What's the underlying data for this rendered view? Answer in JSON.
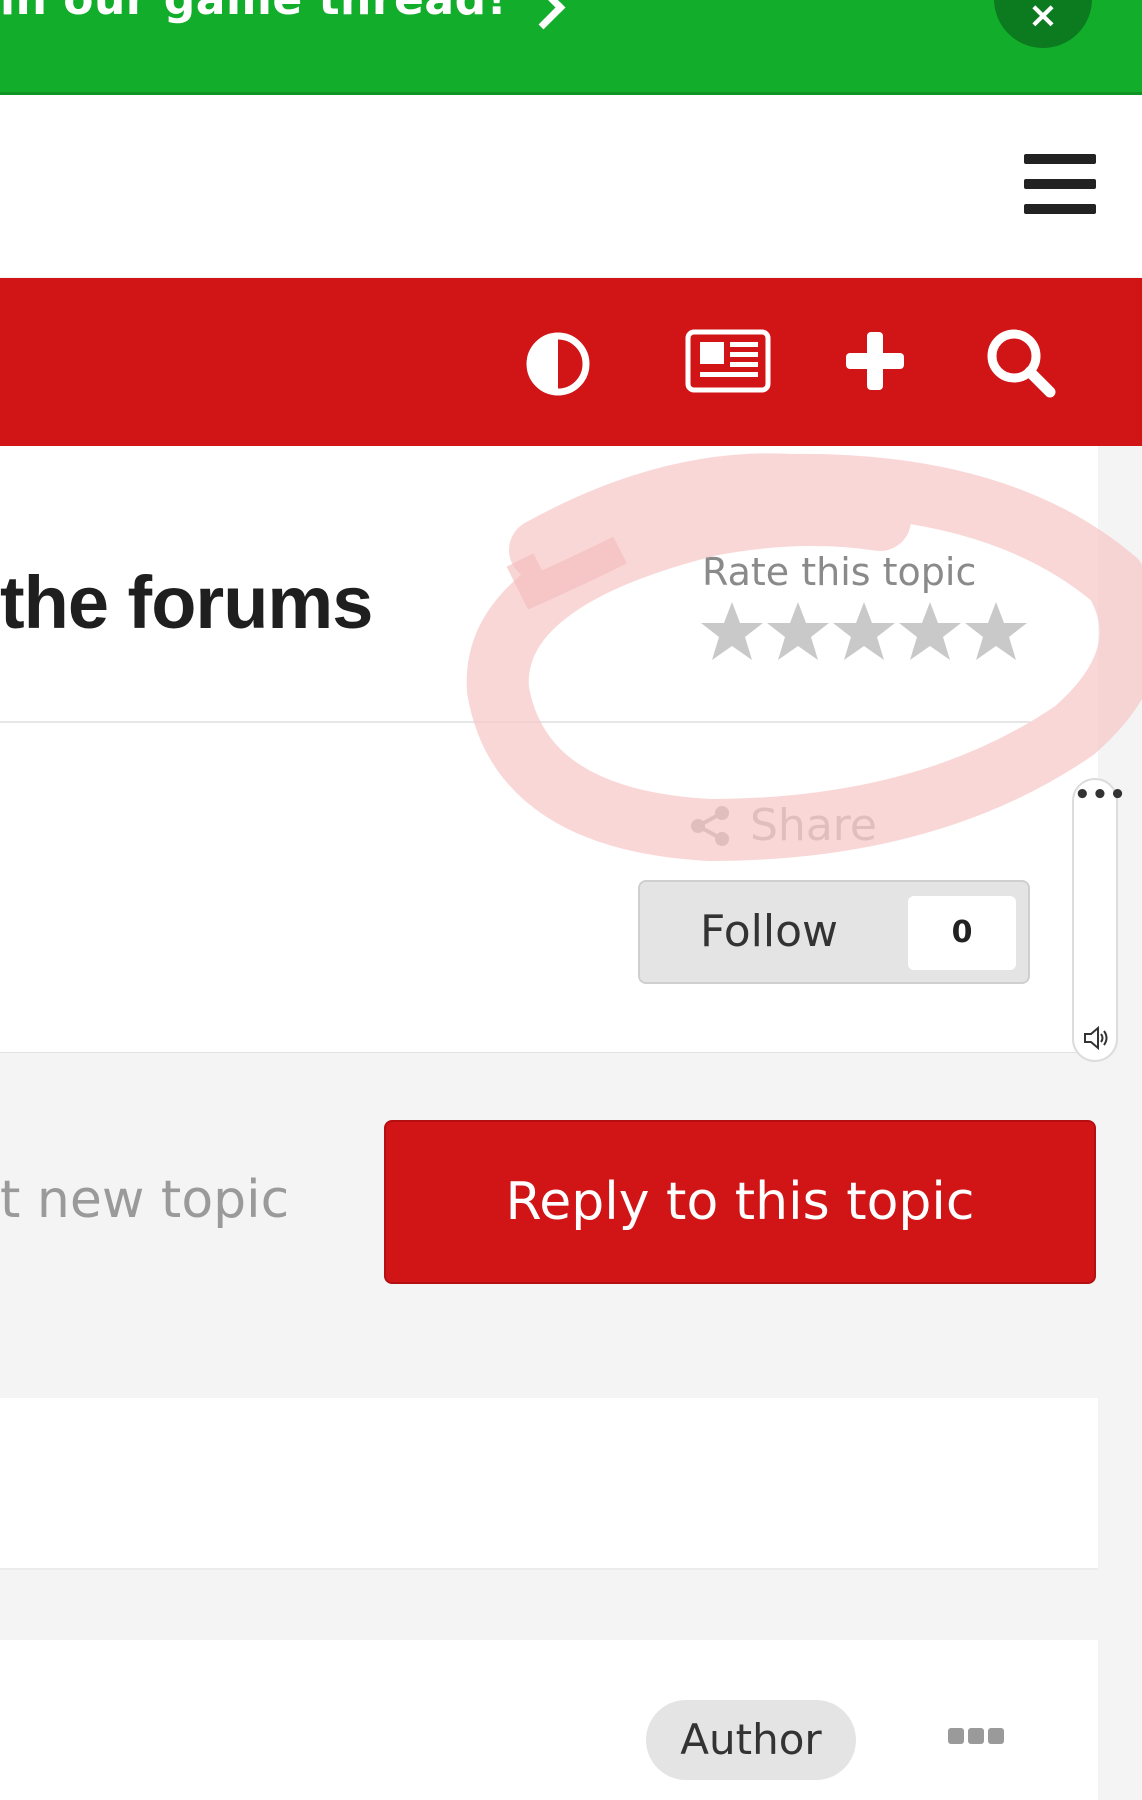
{
  "announcement": {
    "text": "in our game thread!",
    "close_label": "×",
    "color": "#12ad2b"
  },
  "header": {
    "menu_icon": "hamburger-menu-icon"
  },
  "navbar": {
    "color": "#d11416",
    "icons": [
      "theme-toggle-icon",
      "news-icon",
      "add-icon",
      "search-icon"
    ]
  },
  "topic": {
    "title": "the forums",
    "rate_label": "Rate this topic",
    "rating": 0,
    "max_rating": 5,
    "share_label": "Share",
    "follow_label": "Follow",
    "follow_count": "0"
  },
  "side_widget": {
    "menu_label": "•••",
    "icon": "speaker-icon"
  },
  "actions": {
    "start_topic_label": "t new topic",
    "reply_label": "Reply to this topic"
  },
  "post": {
    "author_badge": "Author",
    "more_icon": "more-options-icon"
  },
  "annotation": {
    "type": "hand-drawn circle",
    "color": "#f7c9c9"
  }
}
